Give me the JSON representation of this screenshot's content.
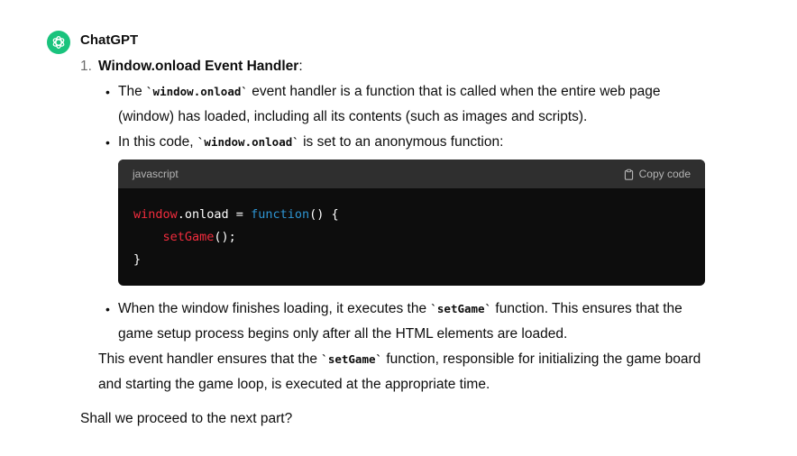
{
  "author": "ChatGPT",
  "item": {
    "number": "1.",
    "title": "Window.onload Event Handler",
    "title_suffix": ":"
  },
  "bullets": {
    "b1_pre": "The ",
    "b1_code": "`window.onload`",
    "b1_post": " event handler is a function that is called when the entire web page (window) has loaded, including all its contents (such as images and scripts).",
    "b2_pre": "In this code, ",
    "b2_code": "`window.onload`",
    "b2_post": " is set to an anonymous function:",
    "b3_pre": "When the window finishes loading, it executes the ",
    "b3_code": "`setGame`",
    "b3_post": " function. This ensures that the game setup process begins only after all the HTML elements are loaded."
  },
  "code_block": {
    "language": "javascript",
    "copy_label": "Copy code",
    "line1_obj": "window",
    "line1_rest": ".onload = ",
    "line1_kw": "function",
    "line1_end": "() {",
    "line2_indent": "    ",
    "line2_fn": "setGame",
    "line2_end": "();",
    "line3": "}"
  },
  "summary": {
    "pre": "This event handler ensures that the ",
    "code": "`setGame`",
    "post": " function, responsible for initializing the game board and starting the game loop, is executed at the appropriate time."
  },
  "question": "Shall we proceed to the next part?"
}
